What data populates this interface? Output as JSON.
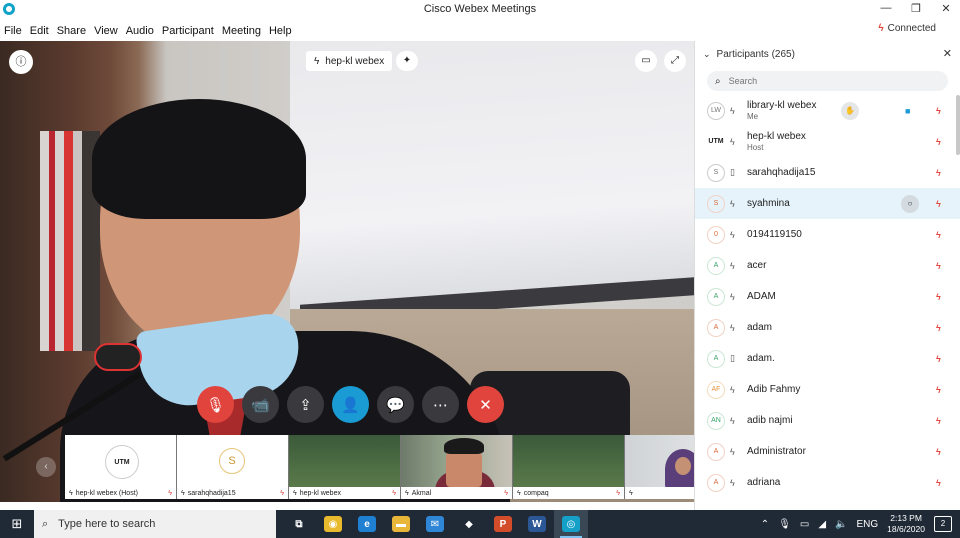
{
  "window": {
    "title": "Cisco Webex Meetings",
    "minimize": "—",
    "restore": "❐",
    "close": "✕"
  },
  "menu": [
    "File",
    "Edit",
    "Share",
    "View",
    "Audio",
    "Participant",
    "Meeting",
    "Help"
  ],
  "status": {
    "connection": "Connected"
  },
  "video": {
    "active_speaker_label": "hep-kl webex"
  },
  "controls": [
    {
      "name": "mute-button",
      "icon": "🎙",
      "style": "red"
    },
    {
      "name": "video-button",
      "icon": "📹",
      "style": "dark"
    },
    {
      "name": "share-button",
      "icon": "⇪",
      "style": "dark"
    },
    {
      "name": "participants-button",
      "icon": "👤",
      "style": "blue"
    },
    {
      "name": "chat-button",
      "icon": "💬",
      "style": "dark"
    },
    {
      "name": "more-button",
      "icon": "⋯",
      "style": "dark"
    },
    {
      "name": "leave-button",
      "icon": "✕",
      "style": "red"
    }
  ],
  "thumbnails": [
    {
      "label": "hep-kl webex (Host)",
      "kind": "utm",
      "logo": "UTM"
    },
    {
      "label": "sarahqhadija15",
      "kind": "avatar",
      "initial": "S"
    },
    {
      "label": "hep-kl webex",
      "kind": "green"
    },
    {
      "label": "Akmal",
      "kind": "person"
    },
    {
      "label": "compaq",
      "kind": "green2"
    },
    {
      "label": "",
      "kind": "hijab"
    }
  ],
  "panel": {
    "title": "Participants (265)",
    "search_placeholder": "Search",
    "participants": [
      {
        "initials": "LW",
        "name": "library-kl webex",
        "sub": "Me",
        "device": "audio",
        "color": "gray",
        "hand": true,
        "video": true
      },
      {
        "initials": "UTM",
        "name": "hep-kl webex",
        "sub": "Host",
        "device": "audio",
        "color": "utm"
      },
      {
        "initials": "S",
        "name": "sarahqhadija15",
        "device": "phone",
        "color": "gray"
      },
      {
        "initials": "S",
        "name": "syahmina",
        "device": "audio",
        "color": "red",
        "selected": true,
        "chat": true
      },
      {
        "initials": "0",
        "name": "0194119150",
        "device": "audio",
        "color": "red"
      },
      {
        "initials": "A",
        "name": "acer",
        "device": "audio",
        "color": "green"
      },
      {
        "initials": "A",
        "name": "ADAM",
        "device": "audio",
        "color": "green"
      },
      {
        "initials": "A",
        "name": "adam",
        "device": "audio",
        "color": "red"
      },
      {
        "initials": "A",
        "name": "adam.",
        "device": "phone",
        "color": "green"
      },
      {
        "initials": "AF",
        "name": "Adib Fahmy",
        "device": "audio",
        "color": "orange"
      },
      {
        "initials": "AN",
        "name": "adib najmi",
        "device": "audio",
        "color": "green"
      },
      {
        "initials": "A",
        "name": "Administrator",
        "device": "audio",
        "color": "red"
      },
      {
        "initials": "A",
        "name": "adriana",
        "device": "audio",
        "color": "red"
      }
    ]
  },
  "taskbar": {
    "search_placeholder": "Type here to search",
    "apps": [
      {
        "name": "task-view-icon",
        "glyph": "⧉",
        "bg": "transparent"
      },
      {
        "name": "chrome-icon",
        "glyph": "◉",
        "bg": "#e9b92e"
      },
      {
        "name": "edge-icon",
        "glyph": "e",
        "bg": "#1f7fd1"
      },
      {
        "name": "file-explorer-icon",
        "glyph": "▬",
        "bg": "#e8b73a"
      },
      {
        "name": "mail-icon",
        "glyph": "✉",
        "bg": "#2f86d6"
      },
      {
        "name": "dropbox-icon",
        "glyph": "◆",
        "bg": "transparent"
      },
      {
        "name": "powerpoint-icon",
        "glyph": "P",
        "bg": "#d34d2a"
      },
      {
        "name": "word-icon",
        "glyph": "W",
        "bg": "#2b5797"
      },
      {
        "name": "webex-icon",
        "glyph": "◎",
        "bg": "#15a0c8",
        "active": true
      }
    ],
    "language": "ENG",
    "time": "2:13 PM",
    "date": "18/6/2020",
    "notifications": "2"
  },
  "colors": {
    "accent": "#1a9bd4",
    "danger": "#e0443c",
    "taskbar": "#1f2a36"
  }
}
